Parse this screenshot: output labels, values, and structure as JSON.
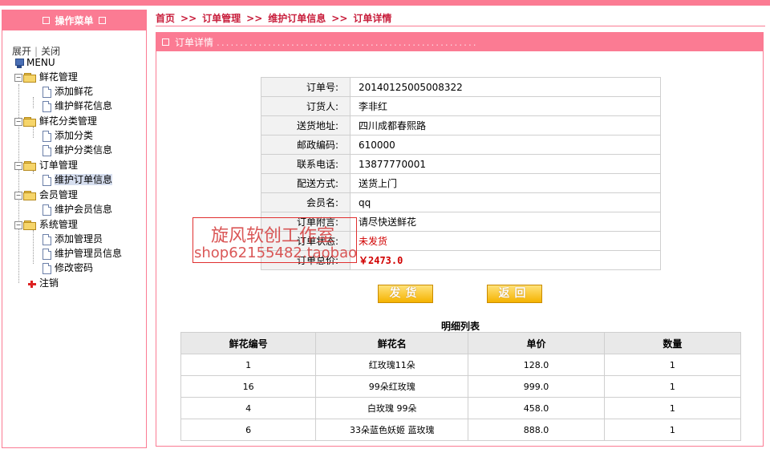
{
  "sidebar": {
    "header": "操作菜单",
    "expand": "展开",
    "collapse": "关闭",
    "root": "MENU",
    "groups": [
      {
        "label": "鲜花管理",
        "items": [
          "添加鲜花",
          "维护鲜花信息"
        ]
      },
      {
        "label": "鲜花分类管理",
        "items": [
          "添加分类",
          "维护分类信息"
        ]
      },
      {
        "label": "订单管理",
        "items": [
          "维护订单信息"
        ]
      },
      {
        "label": "会员管理",
        "items": [
          "维护会员信息"
        ]
      },
      {
        "label": "系统管理",
        "items": [
          "添加管理员",
          "维护管理员信息",
          "修改密码"
        ]
      }
    ],
    "logout": "注销"
  },
  "breadcrumb": {
    "items": [
      "首页",
      "订单管理",
      "维护订单信息",
      "订单详情"
    ],
    "separator": ">>"
  },
  "panel": {
    "title": "订单详情",
    "dots": "........................................................"
  },
  "order": {
    "rows": [
      {
        "label": "订单号:",
        "value": "20140125005008322"
      },
      {
        "label": "订货人:",
        "value": "李非红"
      },
      {
        "label": "送货地址:",
        "value": "四川成都春熙路"
      },
      {
        "label": "邮政编码:",
        "value": "610000"
      },
      {
        "label": "联系电话:",
        "value": "13877770001"
      },
      {
        "label": "配送方式:",
        "value": "送货上门"
      },
      {
        "label": "会员名:",
        "value": "qq"
      },
      {
        "label": "订单附言:",
        "value": "请尽快送鲜花"
      },
      {
        "label": "订单状态:",
        "value": "未发货"
      },
      {
        "label": "订单总价:",
        "value": "￥2473.0"
      }
    ]
  },
  "buttons": {
    "ship": "发货",
    "back": "返回"
  },
  "detail_list": {
    "title": "明细列表",
    "headers": [
      "鲜花编号",
      "鲜花名",
      "单价",
      "数量"
    ],
    "rows": [
      [
        "1",
        "红玫瑰11朵",
        "128.0",
        "1"
      ],
      [
        "16",
        "99朵红玫瑰",
        "999.0",
        "1"
      ],
      [
        "4",
        "白玫瑰 99朵",
        "458.0",
        "1"
      ],
      [
        "6",
        "33朵蓝色妖姬 蓝玫瑰",
        "888.0",
        "1"
      ]
    ]
  },
  "watermark": {
    "line1": "旋风软创工作室",
    "line2": "shop62155482.taobao"
  },
  "colors": {
    "accent": "#fb7b93",
    "link": "#c81e3c",
    "status_red": "#d10000",
    "button_gold": "#f5b300"
  }
}
